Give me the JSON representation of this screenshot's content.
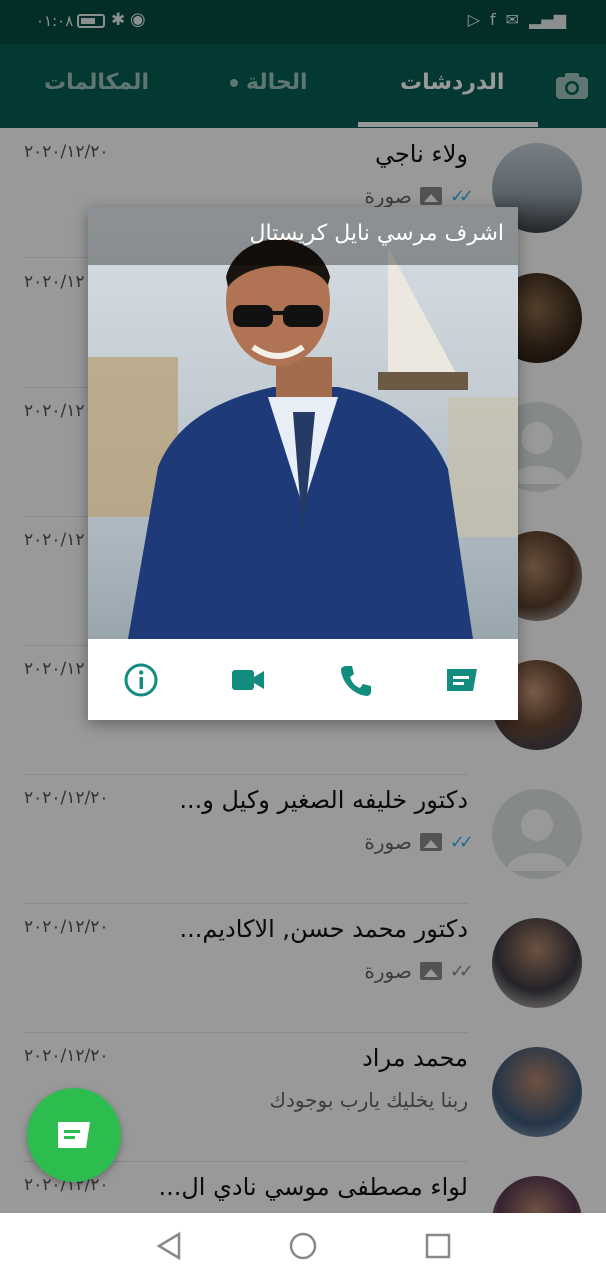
{
  "statusbar": {
    "time": "٠١:٠٨"
  },
  "tabs": [
    {
      "label": "الدردشات",
      "active": true
    },
    {
      "label": "الحالة",
      "active": false
    },
    {
      "label": "المكالمات",
      "active": false
    }
  ],
  "chats": [
    {
      "name": "ولاء ناجي",
      "date": "٢٠٢٠/١٢/٢٠",
      "message": "صورة",
      "ticks": "read"
    },
    {
      "name": "",
      "date": "٢٠٢٠/١٢",
      "message": ""
    },
    {
      "name": "",
      "date": "٢٠٢٠/١٢",
      "message": ""
    },
    {
      "name": "",
      "date": "٢٠٢٠/١٢",
      "message": ""
    },
    {
      "name": "",
      "date": "٢٠٢٠/١٢",
      "message": ""
    },
    {
      "name": "دكتور خليفه الصغير وكيل و...",
      "date": "٢٠٢٠/١٢/٢٠",
      "message": "صورة",
      "ticks": "read"
    },
    {
      "name": "دكتور محمد حسن, الاكاديم...",
      "date": "٢٠٢٠/١٢/٢٠",
      "message": "صورة",
      "ticks": "delivered"
    },
    {
      "name": "محمد مراد",
      "date": "٢٠٢٠/١٢/٢٠",
      "message": "ربنا يخليك يارب بوجودك"
    },
    {
      "name": "لواء مصطفى موسي نادي ال...",
      "date": "٢٠٢٠/١٢/٢٠",
      "message": ""
    }
  ],
  "popup": {
    "contact_name": "اشرف مرسي نايل كريستال",
    "actions": [
      "message",
      "call",
      "video",
      "info"
    ]
  },
  "colors": {
    "header": "#075e54",
    "accent": "#128c7e",
    "fab": "#2dbd4e",
    "read_ticks": "#34b7f1"
  }
}
